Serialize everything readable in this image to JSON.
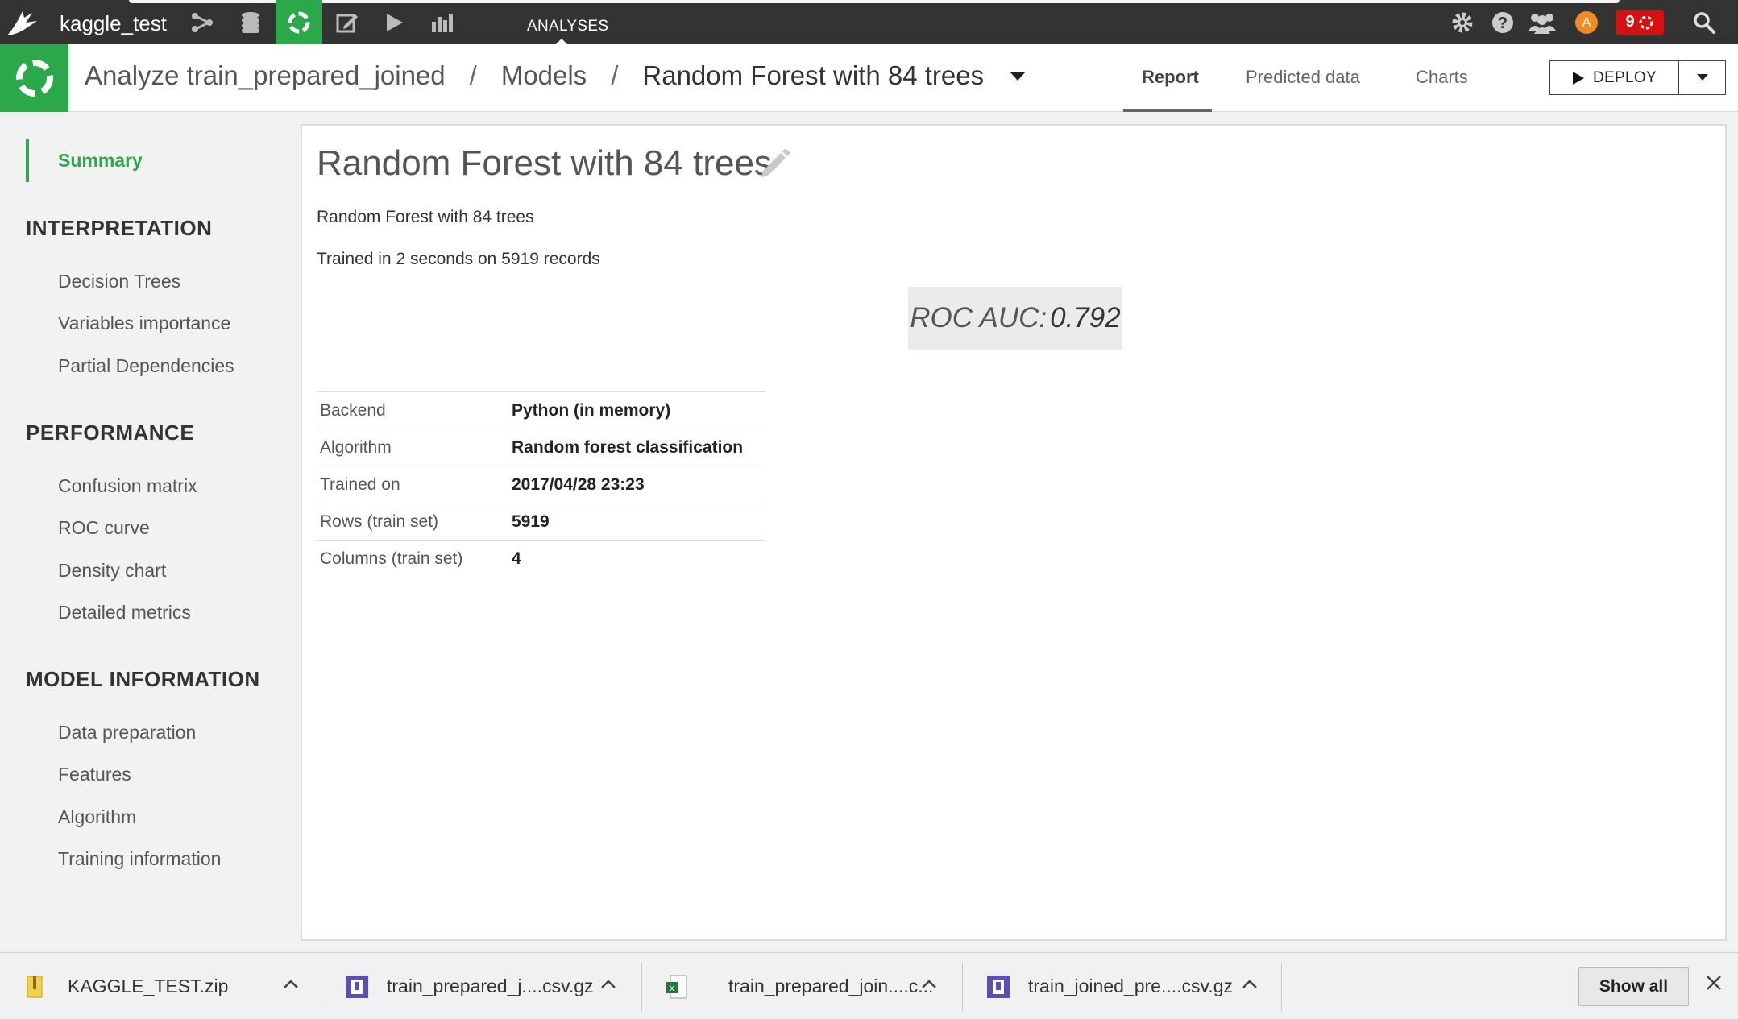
{
  "topbar": {
    "project_name": "kaggle_test",
    "section_label": "ANALYSES",
    "user_initial": "A",
    "notification_count": "9"
  },
  "header": {
    "breadcrumb": {
      "analysis": "Analyze train_prepared_joined",
      "sep1": "/",
      "models": "Models",
      "sep2": "/",
      "current": "Random Forest with 84 trees"
    },
    "tabs": {
      "report": "Report",
      "predicted_data": "Predicted data",
      "charts": "Charts"
    },
    "deploy_label": "DEPLOY"
  },
  "sidebar": {
    "summary": "Summary",
    "interpretation_heading": "INTERPRETATION",
    "interpretation_items": [
      "Decision Trees",
      "Variables importance",
      "Partial Dependencies"
    ],
    "performance_heading": "PERFORMANCE",
    "performance_items": [
      "Confusion matrix",
      "ROC curve",
      "Density chart",
      "Detailed metrics"
    ],
    "model_info_heading": "MODEL INFORMATION",
    "model_info_items": [
      "Data preparation",
      "Features",
      "Algorithm",
      "Training information"
    ]
  },
  "main": {
    "title": "Random Forest with 84 trees",
    "description": "Random Forest with 84 trees",
    "trained_note": "Trained in 2 seconds on 5919 records",
    "metric_label": "ROC AUC:",
    "metric_value": "0.792",
    "properties": [
      {
        "key": "Backend",
        "value": "Python (in memory)"
      },
      {
        "key": "Algorithm",
        "value": "Random forest classification"
      },
      {
        "key": "Trained on",
        "value": "2017/04/28 23:23"
      },
      {
        "key": "Rows (train set)",
        "value": "5919"
      },
      {
        "key": "Columns (train set)",
        "value": "4"
      }
    ]
  },
  "downloads": {
    "items": [
      {
        "name": "KAGGLE_TEST.zip",
        "icon": "zip-file-icon"
      },
      {
        "name": "train_prepared_j....csv.gz",
        "icon": "gz-file-icon"
      },
      {
        "name": "train_prepared_join....c...",
        "icon": "excel-file-icon"
      },
      {
        "name": "train_joined_pre....csv.gz",
        "icon": "gz-file-icon"
      }
    ],
    "show_all": "Show all"
  },
  "colors": {
    "accent_green": "#2aa84a",
    "topbar": "#333333",
    "notification_red": "#d80f0f",
    "avatar_orange": "#f08a24"
  }
}
